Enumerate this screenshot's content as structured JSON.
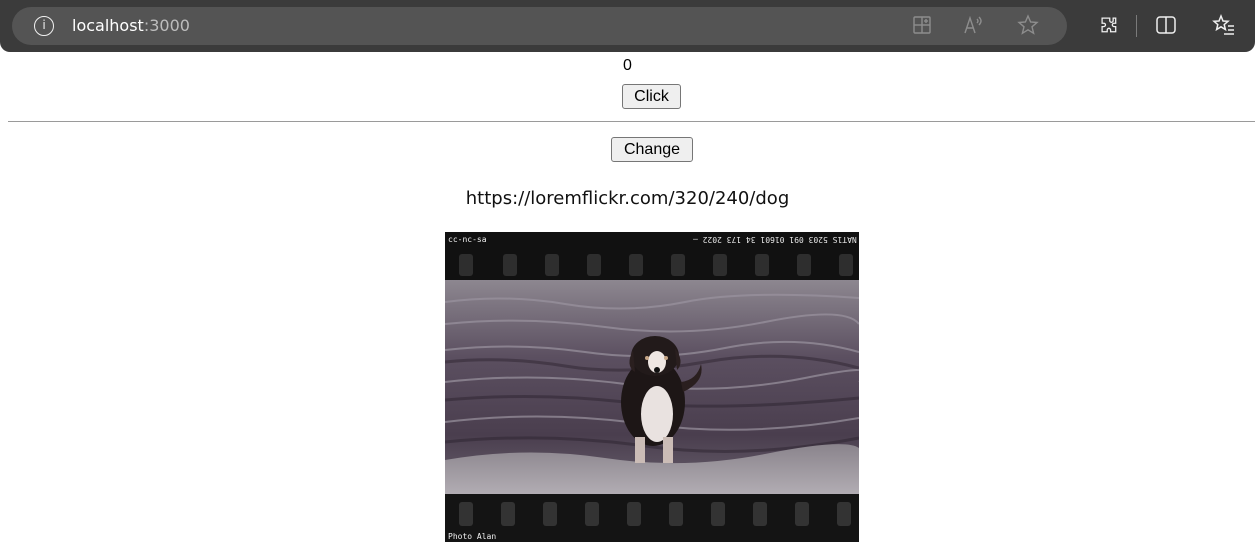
{
  "browser": {
    "address": {
      "host": "localhost",
      "port": ":3000"
    },
    "icons": [
      "info-icon",
      "app-grid-icon",
      "read-aloud-icon",
      "favorite-star-icon",
      "extensions-icon",
      "split-screen-icon",
      "favorites-list-icon"
    ]
  },
  "page": {
    "counter_value": "0",
    "click_button_label": "Click",
    "change_button_label": "Change",
    "image_url": "https://loremflickr.com/320/240/dog"
  },
  "photo": {
    "license_text": "cc-nc-sa",
    "credit_text": "Photo Alan",
    "film_code_text": "NAT1S 5203 091 01601 34 173 2022 —",
    "alt": "dog"
  }
}
